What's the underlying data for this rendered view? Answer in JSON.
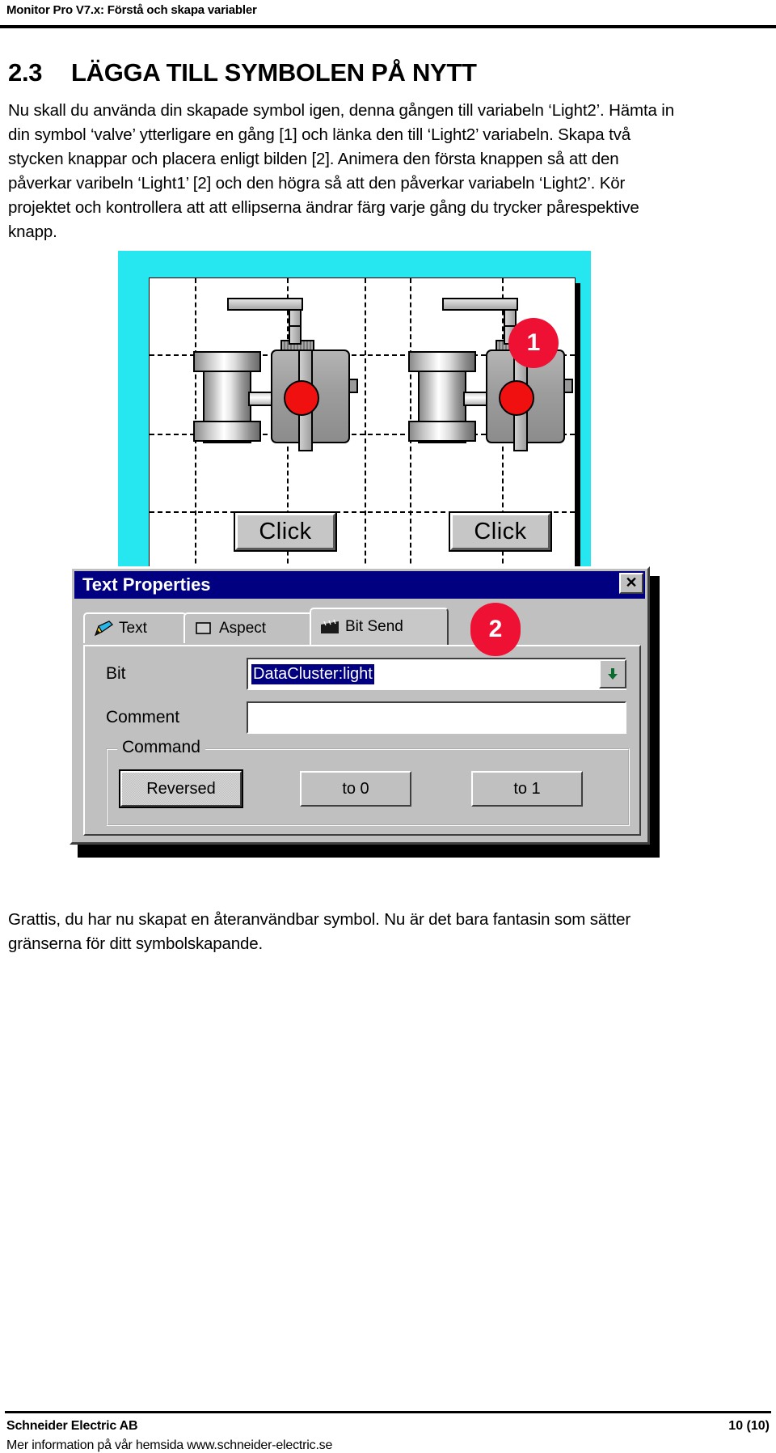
{
  "header": {
    "running_title": "Monitor Pro V7.x: Förstå och skapa variabler"
  },
  "section": {
    "number": "2.3",
    "title": "LÄGGA TILL SYMBOLEN PÅ NYTT",
    "body": "Nu skall du använda din skapade symbol igen, denna gången till variabeln ‘Light2’. Hämta in din symbol ‘valve’ ytterligare en gång [1] och länka den till ‘Light2’ variabeln. Skapa två stycken knappar och placera enligt bilden [2]. Animera den första knappen så att den påverkar varibeln ‘Light1’ [2] och den högra så att den påverkar variabeln ‘Light2’. Kör projektet och kontrollera att att ellipserna ändrar färg varje gång du trycker pårespektive knapp."
  },
  "figure1": {
    "name": "runtime-screen-capture",
    "background_color": "#26e7ef",
    "callout": "1",
    "buttons": [
      {
        "label": "Click"
      },
      {
        "label": "Click"
      }
    ],
    "led_color": "#f01010"
  },
  "dialog": {
    "title": "Text Properties",
    "close_label": "✕",
    "callout": "2",
    "tabs": [
      {
        "label": "Text",
        "icon": "pen-icon",
        "active": false
      },
      {
        "label": "Aspect",
        "icon": "square-icon",
        "active": false
      },
      {
        "label": "Bit Send",
        "icon": "clapperboard-icon",
        "active": true
      }
    ],
    "fields": [
      {
        "label": "Bit",
        "value": "DataCluster:light",
        "selected": true
      },
      {
        "label": "Comment",
        "value": "",
        "selected": false
      }
    ],
    "command_group": {
      "legend": "Command",
      "buttons": [
        {
          "label": "Reversed",
          "focused": true
        },
        {
          "label": "to 0",
          "focused": false
        },
        {
          "label": "to 1",
          "focused": false
        }
      ]
    }
  },
  "closing": {
    "text": "Grattis, du har nu skapat en återanvändbar symbol. Nu är det bara fantasin som sätter gränserna för ditt symbolskapande."
  },
  "footer": {
    "company": "Schneider Electric AB",
    "info": "Mer information på vår hemsida www.schneider-electric.se",
    "page": "10 (10)"
  }
}
